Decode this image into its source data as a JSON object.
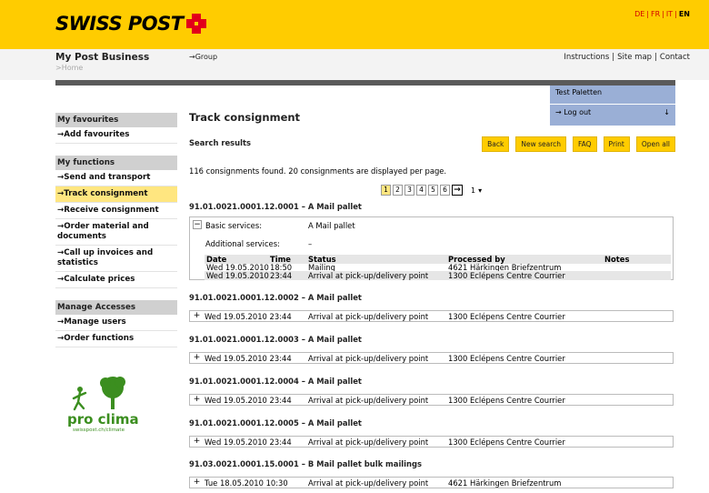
{
  "header": {
    "brand": "SWISS POST",
    "languages": [
      "DE",
      "FR",
      "IT",
      "EN"
    ],
    "active_language": "EN",
    "brand_color": "#ffcc00",
    "cross_color": "#e2001a"
  },
  "subheader": {
    "title": "My Post Business",
    "breadcrumb_home": ">Home",
    "group_link": "→Group",
    "links": [
      "Instructions",
      "Site map",
      "Contact"
    ]
  },
  "user_panel": {
    "user_name": "Test Paletten",
    "logout": "→ Log out",
    "collapse_icon": "↓"
  },
  "sidebar": {
    "favourites_title": "My favourites",
    "favourites": [
      "→Add favourites"
    ],
    "functions_title": "My functions",
    "functions": [
      "→Send and transport",
      "→Track consignment",
      "→Receive consignment",
      "→Order material and documents",
      "→Call up invoices and statistics",
      "→Calculate prices"
    ],
    "active_function": "→Track consignment",
    "accesses_title": "Manage Accesses",
    "accesses": [
      "→Manage users",
      "→Order functions"
    ],
    "promo_text": "pro clima",
    "promo_sub": "swisspost.ch/climate"
  },
  "main": {
    "title": "Track consignment",
    "search_results_label": "Search results",
    "buttons": [
      "Back",
      "New search",
      "FAQ",
      "Print",
      "Open all"
    ],
    "found_text": "116 consignments found. 20 consignments are displayed per page.",
    "pages": [
      "1",
      "2",
      "3",
      "4",
      "5",
      "6"
    ],
    "current_page": "1",
    "next_arrow": "→",
    "page_select": "1"
  },
  "consignments": [
    {
      "title": "91.01.0021.0001.12.0001 – A Mail pallet",
      "expanded": true,
      "basic_services_label": "Basic services:",
      "basic_services_value": "A Mail pallet",
      "additional_services_label": "Additional services:",
      "additional_services_value": "–",
      "columns": [
        "Date",
        "Time",
        "Status",
        "Processed by",
        "Notes"
      ],
      "events": [
        {
          "date": "Wed 19.05.2010",
          "time": "18:50",
          "status": "Mailing",
          "processed_by": "4621 Härkingen Briefzentrum",
          "notes": ""
        },
        {
          "date": "Wed 19.05.2010",
          "time": "23:44",
          "status": "Arrival at pick-up/delivery point",
          "processed_by": "1300 Eclépens Centre Courrier",
          "notes": ""
        }
      ]
    },
    {
      "title": "91.01.0021.0001.12.0002 – A Mail pallet",
      "expanded": false,
      "date": "Wed 19.05.2010  23:44",
      "status": "Arrival at pick-up/delivery point",
      "processed_by": "1300 Eclépens Centre Courrier"
    },
    {
      "title": "91.01.0021.0001.12.0003 – A Mail pallet",
      "expanded": false,
      "date": "Wed 19.05.2010  23:44",
      "status": "Arrival at pick-up/delivery point",
      "processed_by": "1300 Eclépens Centre Courrier"
    },
    {
      "title": "91.01.0021.0001.12.0004 – A Mail pallet",
      "expanded": false,
      "date": "Wed 19.05.2010  23:44",
      "status": "Arrival at pick-up/delivery point",
      "processed_by": "1300 Eclépens Centre Courrier"
    },
    {
      "title": "91.01.0021.0001.12.0005 – A Mail pallet",
      "expanded": false,
      "date": "Wed 19.05.2010  23:44",
      "status": "Arrival at pick-up/delivery point",
      "processed_by": "1300 Eclépens Centre Courrier"
    },
    {
      "title": "91.03.0021.0001.15.0001 – B Mail pallet bulk mailings",
      "expanded": false,
      "date": "Tue  18.05.2010  10:30",
      "status": "Arrival at pick-up/delivery point",
      "processed_by": "4621 Härkingen Briefzentrum"
    }
  ]
}
